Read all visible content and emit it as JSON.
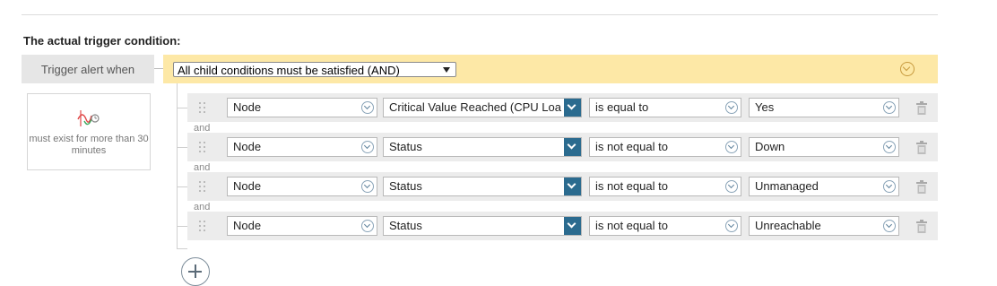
{
  "section": {
    "title": "The actual trigger condition:"
  },
  "trigger": {
    "label": "Trigger alert when"
  },
  "group": {
    "mode_value": "All child conditions must be satisfied (AND)"
  },
  "time_condition": {
    "text": "must exist for more than 30 minutes",
    "icon": "pulse-chart-icon"
  },
  "conditions": [
    {
      "object": "Node",
      "field": "Critical Value Reached (CPU Loa",
      "operator": "is equal to",
      "value": "Yes"
    },
    {
      "object": "Node",
      "field": "Status",
      "operator": "is not equal to",
      "value": "Down"
    },
    {
      "object": "Node",
      "field": "Status",
      "operator": "is not equal to",
      "value": "Unmanaged"
    },
    {
      "object": "Node",
      "field": "Status",
      "operator": "is not equal to",
      "value": "Unreachable"
    }
  ],
  "joiners": [
    "and",
    "and",
    "and"
  ],
  "colors": {
    "group_bar": "#fde8a6",
    "row_bg": "#ececec",
    "metric_button": "#2b6b8f"
  }
}
